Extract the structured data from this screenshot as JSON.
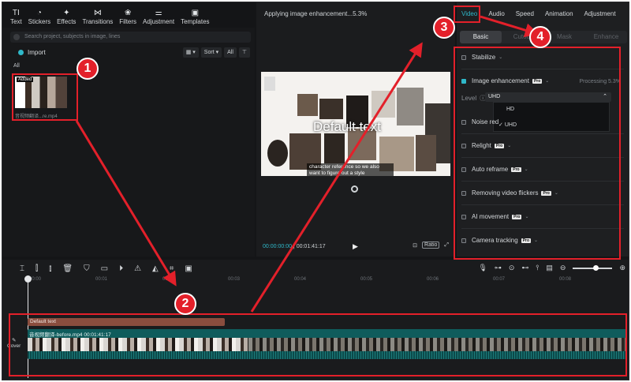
{
  "toolbar": {
    "items": [
      {
        "label": "Text",
        "icon": "text-icon",
        "glyph": "TI"
      },
      {
        "label": "Stickers",
        "icon": "sticker-icon",
        "glyph": "◔"
      },
      {
        "label": "Effects",
        "icon": "effects-icon",
        "glyph": "✦"
      },
      {
        "label": "Transitions",
        "icon": "transitions-icon",
        "glyph": "⋈"
      },
      {
        "label": "Filters",
        "icon": "filters-icon",
        "glyph": "❀"
      },
      {
        "label": "Adjustment",
        "icon": "adjustment-icon",
        "glyph": "⚌"
      },
      {
        "label": "Templates",
        "icon": "templates-icon",
        "glyph": "▣"
      }
    ]
  },
  "media": {
    "search_placeholder": "Search project, subjects in image, lines",
    "import_label": "Import",
    "sort_label": "Sort",
    "all_button": "All",
    "filter_label": "All",
    "thumb_tag": "Added",
    "thumb_name": "音视频翻译...re.mp4"
  },
  "preview": {
    "title": "Applying image enhancement...5.3%",
    "default_text": "Default text",
    "caption": "character reference so we also want to figure out a style",
    "current_time": "00:00:00:00",
    "total_time": "00:01:41:17",
    "ratio_label": "Ratio"
  },
  "props": {
    "tabs": [
      "Video",
      "Audio",
      "Speed",
      "Animation",
      "Adjustment"
    ],
    "active_tab": "Video",
    "subtabs": [
      "Basic",
      "Cutout",
      "Mask",
      "Enhance"
    ],
    "active_subtab": "Basic",
    "stabilize": "Stabilize",
    "image_enhancement": "Image enhancement",
    "processing": "Processing 5.3%",
    "level_label": "Level",
    "level_value": "UHD",
    "level_options": [
      "HD",
      "UHD"
    ],
    "noise_reduction": "Noise red",
    "relight": "Relight",
    "auto_reframe": "Auto reframe",
    "removing_flickers": "Removing video flickers",
    "ai_movement": "AI movement",
    "camera_tracking": "Camera tracking",
    "pro_badge": "Pro"
  },
  "timeline": {
    "ruler": [
      "00:00",
      "00:01",
      "00:02",
      "00:03",
      "00:04",
      "00:05",
      "00:06",
      "00:07",
      "00:08"
    ],
    "text_clip": "Default text",
    "video_clip": "音视频翻译-before.mp4  00:01:41:17",
    "cover_label": "Cover"
  },
  "annotations": {
    "badges": [
      "1",
      "2",
      "3",
      "4"
    ],
    "color": "#e3202a"
  },
  "accent_color": "#2fb8c9"
}
